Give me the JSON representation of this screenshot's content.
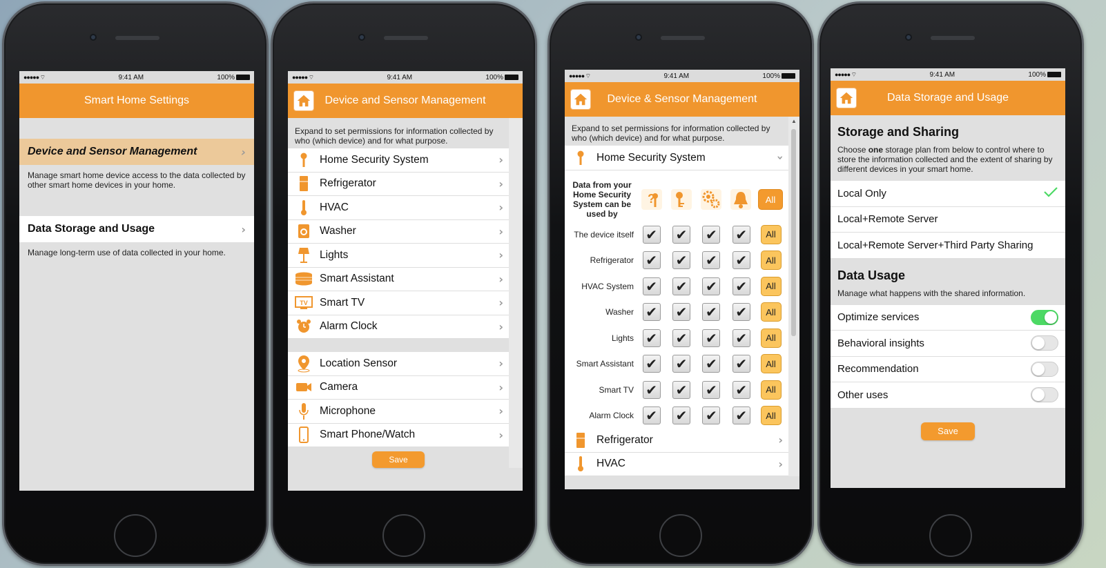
{
  "status": {
    "time": "9:41 AM",
    "battery": "100%"
  },
  "phone1": {
    "title": "Smart Home Settings",
    "sections": [
      {
        "label": "Device and Sensor Management",
        "desc": "Manage smart home device access to the data collected by other smart home devices in your home."
      },
      {
        "label": "Data Storage and Usage",
        "desc": "Manage long-term use of data collected in your home."
      }
    ]
  },
  "phone2": {
    "title": "Device and Sensor Management",
    "intro": "Expand to set permissions for information collected by who (which device) and for what purpose.",
    "devices": [
      {
        "label": "Home Security System",
        "icon": "key-icon"
      },
      {
        "label": "Refrigerator",
        "icon": "refrigerator-icon"
      },
      {
        "label": "HVAC",
        "icon": "thermometer-icon"
      },
      {
        "label": "Washer",
        "icon": "washer-icon"
      },
      {
        "label": "Lights",
        "icon": "lamp-icon"
      },
      {
        "label": "Smart Assistant",
        "icon": "smart-assistant-icon"
      },
      {
        "label": "Smart TV",
        "icon": "tv-icon"
      },
      {
        "label": "Alarm Clock",
        "icon": "alarm-clock-icon"
      }
    ],
    "sensors": [
      {
        "label": "Location Sensor",
        "icon": "location-pin-icon"
      },
      {
        "label": "Camera",
        "icon": "camera-icon"
      },
      {
        "label": "Microphone",
        "icon": "microphone-icon"
      },
      {
        "label": "Smart Phone/Watch",
        "icon": "smartphone-icon"
      }
    ],
    "save": "Save"
  },
  "phone3": {
    "title": "Device & Sensor Management",
    "intro": "Expand to set permissions for information collected by who (which device) and for what purpose.",
    "expanded": "Home Security System",
    "table_header": "Data from your Home Security System can be used by",
    "purpose_icons": [
      "question-purpose-icon",
      "key-purpose-icon",
      "gears-purpose-icon",
      "bell-purpose-icon"
    ],
    "all_label": "All",
    "rows": [
      "The device itself",
      "Refrigerator",
      "HVAC System",
      "Washer",
      "Lights",
      "Smart Assistant",
      "Smart TV",
      "Alarm Clock"
    ],
    "after": [
      "Refrigerator",
      "HVAC"
    ]
  },
  "phone4": {
    "title": "Data Storage and Usage",
    "storage_title": "Storage and Sharing",
    "storage_desc_pre": "Choose ",
    "storage_desc_bold": "one",
    "storage_desc_post": " storage plan from below to control where to store the information collected and the extent of sharing by different devices in your smart home.",
    "storage_options": [
      "Local Only",
      "Local+Remote Server",
      "Local+Remote Server+Third Party Sharing"
    ],
    "selected_option": "Local Only",
    "usage_title": "Data Usage",
    "usage_desc": "Manage what happens with the shared information.",
    "usage_options": [
      {
        "label": "Optimize services",
        "on": true
      },
      {
        "label": "Behavioral insights",
        "on": false
      },
      {
        "label": "Recommendation",
        "on": false
      },
      {
        "label": "Other uses",
        "on": false
      }
    ],
    "save": "Save",
    "accent": "#f0962e",
    "toggle_on_color": "#4cd964"
  }
}
